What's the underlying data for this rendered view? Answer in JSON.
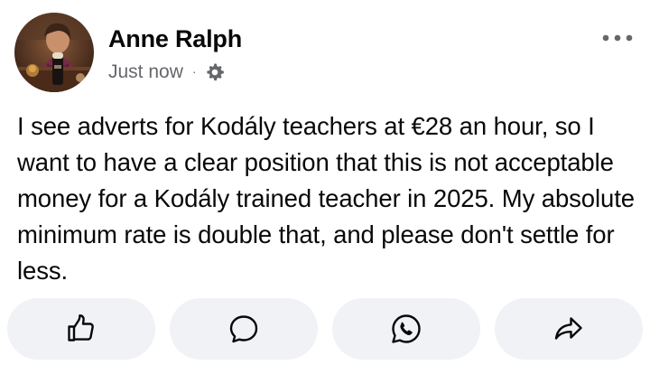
{
  "post": {
    "author": "Anne Ralph",
    "timestamp": "Just now",
    "separator": "·",
    "privacy_icon": "gear-icon",
    "body": "I see adverts for Kodály teachers at €28 an hour, so I want to have a clear position that this is not acceptable money for a Kodály trained teacher in 2025. My absolute minimum rate is double that, and please don't settle for less."
  },
  "actions": [
    {
      "id": "like",
      "icon": "thumbs-up-icon"
    },
    {
      "id": "comment",
      "icon": "comment-bubble-icon"
    },
    {
      "id": "whatsapp",
      "icon": "whatsapp-icon"
    },
    {
      "id": "share",
      "icon": "share-arrow-icon"
    }
  ],
  "colors": {
    "text_primary": "#080809",
    "text_secondary": "#65676b",
    "button_background": "#f0f2f5",
    "icon": "#080809"
  }
}
